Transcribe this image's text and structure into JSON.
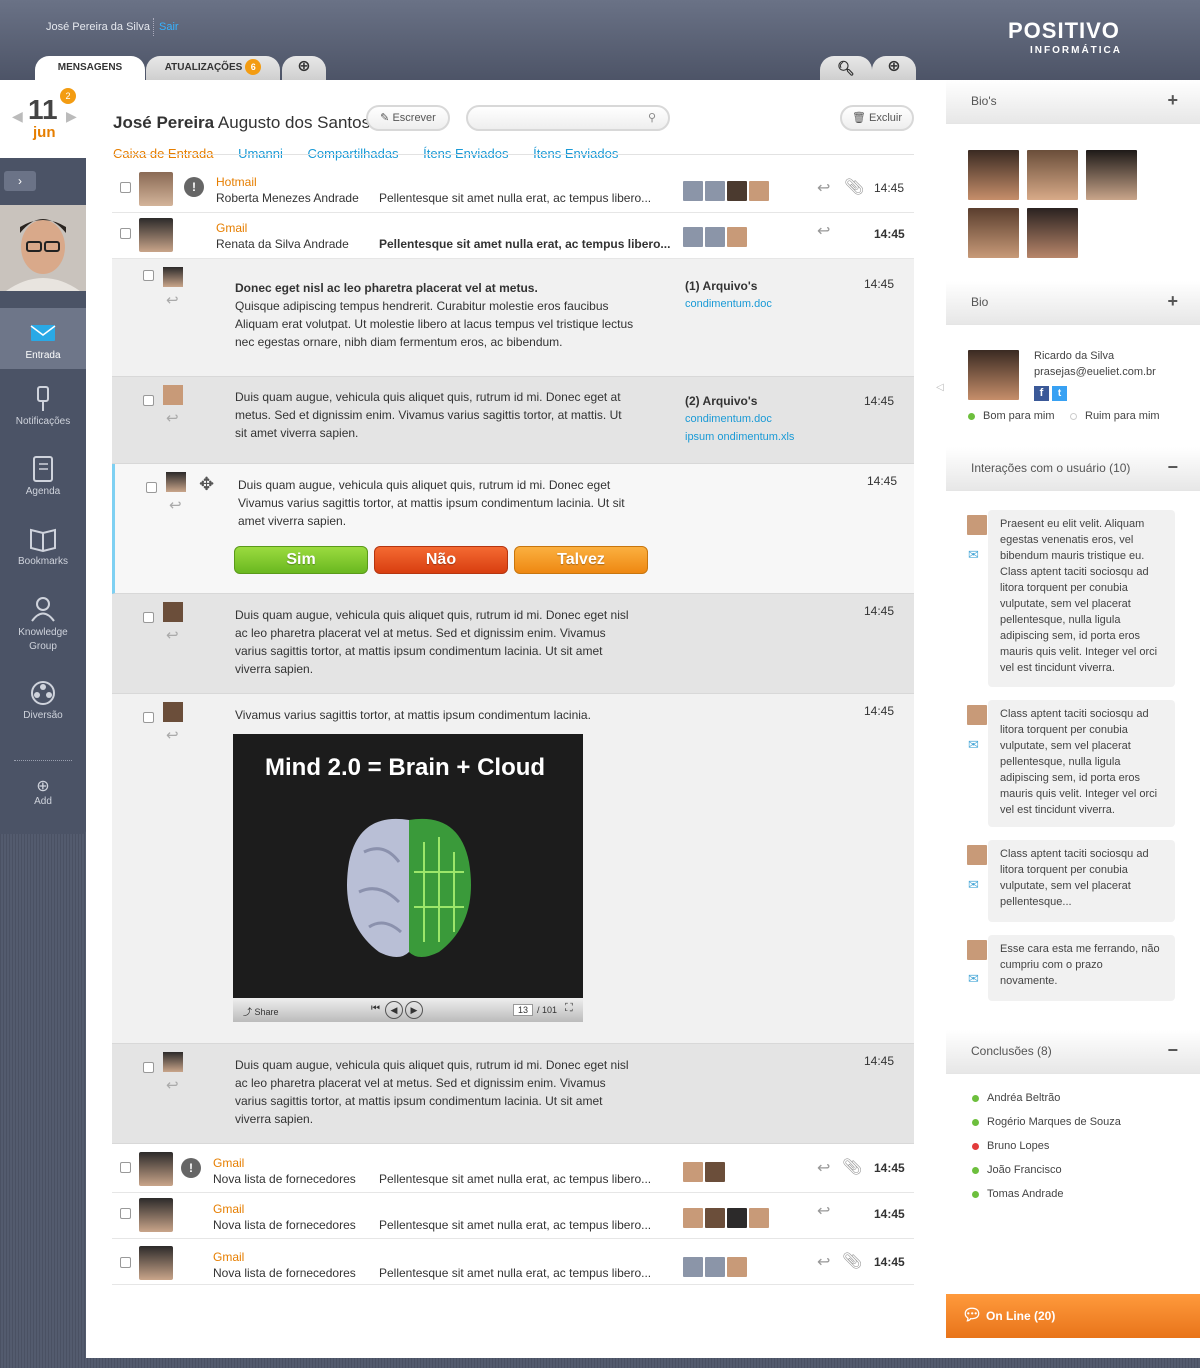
{
  "topbar": {
    "user_name": "José Pereira da Silva",
    "logout": "Sair",
    "logo_line1": "POSITIVO",
    "logo_line2": "INFORMÁTICA"
  },
  "tabs": [
    {
      "label": "MENSAGENS"
    },
    {
      "label": "ATUALIZAÇÕES",
      "badge": "6"
    }
  ],
  "date": {
    "day": "11",
    "month": "jun",
    "badge": "2"
  },
  "sidebar": {
    "items": [
      {
        "label": "Entrada"
      },
      {
        "label": "Notificações"
      },
      {
        "label": "Agenda"
      },
      {
        "label": "Bookmarks"
      },
      {
        "label": "Knowledge Group"
      },
      {
        "label": "Diversão"
      },
      {
        "label": "Add"
      }
    ]
  },
  "header": {
    "name_bold": "José Pereira",
    "name_rest": " Augusto dos Santos",
    "write": "Escrever",
    "delete": "Excluir",
    "search_placeholder": ""
  },
  "folders": [
    "Caixa de Entrada",
    "Umanni",
    "Compartilhadas",
    "Ítens Enviados",
    "Ítens Enviados"
  ],
  "messages_top": [
    {
      "source": "Hotmail",
      "from": "Roberta Menezes Andrade",
      "preview": "Pellentesque sit amet nulla erat, ac tempus libero...",
      "time": "14:45"
    },
    {
      "source": "Gmail",
      "from": "Renata da Silva Andrade",
      "preview": "Pellentesque sit amet nulla erat, ac tempus libero...",
      "time": "14:45"
    }
  ],
  "thread": [
    {
      "title": "Donec eget nisl ac leo pharetra placerat vel at metus.",
      "body": "Quisque adipiscing tempus hendrerit. Curabitur molestie eros faucibus Aliquam erat volutpat. Ut molestie libero at lacus tempus vel tristique lectus nec egestas ornare, nibh diam fermentum eros, ac bibendum.",
      "att_head": "(1) Arquivo's",
      "att_links": [
        "condimentum.doc"
      ],
      "time": "14:45"
    },
    {
      "body": "Duis quam augue, vehicula quis aliquet quis, rutrum id mi. Donec eget at metus. Sed et dignissim enim. Vivamus varius sagittis tortor, at mattis. Ut sit amet viverra sapien.",
      "att_head": "(2) Arquivo's",
      "att_links": [
        "condimentum.doc",
        "ipsum ondimentum.xls"
      ],
      "time": "14:45"
    },
    {
      "body": "Duis quam augue, vehicula quis aliquet quis, rutrum id mi. Donec eget Vivamus varius sagittis tortor, at mattis ipsum condimentum lacinia. Ut sit amet viverra sapien.",
      "time": "14:45",
      "votes": [
        "Sim",
        "Não",
        "Talvez"
      ]
    },
    {
      "body": "Duis quam augue, vehicula quis aliquet quis, rutrum id mi. Donec eget nisl ac leo pharetra placerat vel at metus. Sed et dignissim enim. Vivamus varius sagittis tortor, at mattis ipsum condimentum lacinia. Ut sit amet viverra sapien.",
      "time": "14:45"
    },
    {
      "body": "Vivamus varius sagittis tortor, at mattis ipsum condimentum lacinia.",
      "time": "14:45",
      "video": {
        "title": "Mind 2.0 = Brain + Cloud",
        "share": "Share",
        "page": "13",
        "total": "/ 101"
      }
    },
    {
      "body": "Duis quam augue, vehicula quis aliquet quis, rutrum id mi. Donec eget nisl ac leo pharetra placerat vel at metus. Sed et dignissim enim. Vivamus varius sagittis tortor, at mattis ipsum condimentum lacinia. Ut sit amet viverra sapien.",
      "time": "14:45"
    }
  ],
  "messages_bottom": [
    {
      "source": "Gmail",
      "from": "Nova lista de fornecedores",
      "preview": "Pellentesque sit amet nulla erat, ac tempus libero...",
      "time": "14:45"
    },
    {
      "source": "Gmail",
      "from": "Nova lista de fornecedores",
      "preview": "Pellentesque sit amet nulla erat, ac tempus libero...",
      "time": "14:45"
    },
    {
      "source": "Gmail",
      "from": "Nova lista de fornecedores",
      "preview": "Pellentesque sit amet nulla erat, ac tempus libero...",
      "time": "14:45"
    }
  ],
  "right": {
    "bios_title": "Bio's",
    "bio_title": "Bio",
    "bio_name": "Ricardo da Silva",
    "bio_email": "prasejas@eueliet.com.br",
    "good": "Bom para mim",
    "bad": "Ruim para mim",
    "interactions_title": "Interações com o usuário (10)",
    "interactions": [
      "Praesent eu elit velit. Aliquam egestas venenatis eros, vel bibendum mauris tristique eu. Class aptent taciti sociosqu ad litora torquent per conubia vulputate, sem vel placerat pellentesque, nulla ligula adipiscing sem, id porta eros mauris quis velit. Integer vel orci vel est tincidunt viverra.",
      "Class aptent taciti sociosqu ad litora torquent per conubia vulputate, sem vel placerat pellentesque, nulla ligula adipiscing sem, id porta eros mauris quis velit. Integer vel orci vel est tincidunt viverra.",
      "Class aptent taciti sociosqu ad litora torquent per conubia vulputate, sem vel placerat pellentesque...",
      "Esse cara esta me ferrando, não cumpriu com o prazo novamente."
    ],
    "conclusions_title": "Conclusões (8)",
    "conclusions": [
      {
        "name": "Andréa Beltrão",
        "color": "#6dbf3d"
      },
      {
        "name": "Rogério Marques de Souza",
        "color": "#6dbf3d"
      },
      {
        "name": "Bruno Lopes",
        "color": "#e23b3b"
      },
      {
        "name": "João Francisco",
        "color": "#6dbf3d"
      },
      {
        "name": "Tomas Andrade",
        "color": "#6dbf3d"
      }
    ],
    "online": "On Line (20)"
  },
  "colors": {
    "accent_orange": "#e67e00",
    "link_blue": "#1a9ad6",
    "sim": "#7cc427",
    "nao": "#e8481c",
    "talvez": "#f39a1c"
  }
}
